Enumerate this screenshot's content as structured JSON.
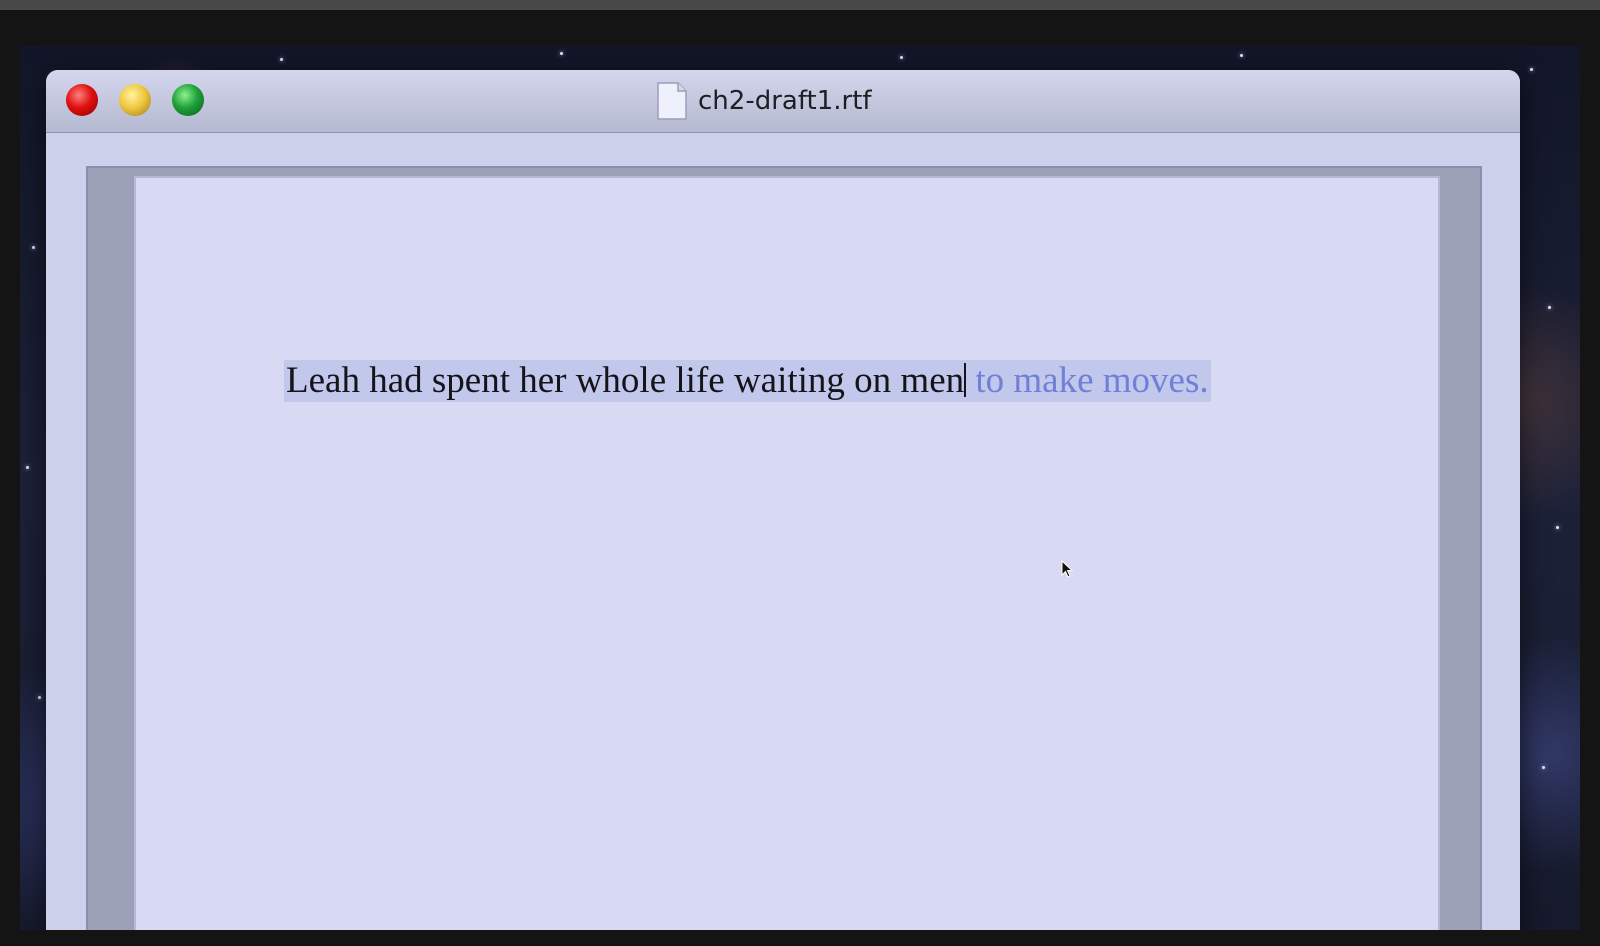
{
  "window": {
    "title": "ch2-draft1.rtf",
    "controls": [
      "close",
      "minimize",
      "maximize"
    ]
  },
  "document": {
    "typed_text": "Leah had spent her whole life waiting on men",
    "suggestion_text": " to make moves."
  },
  "colors": {
    "close": "#e01010",
    "minimize": "#f0c840",
    "maximize": "#1ea13a",
    "suggestion": "#6f80d6",
    "selection_highlight": "#c2c7ec"
  },
  "icons": {
    "document": "document-icon",
    "pointer": "mouse-pointer-icon"
  }
}
